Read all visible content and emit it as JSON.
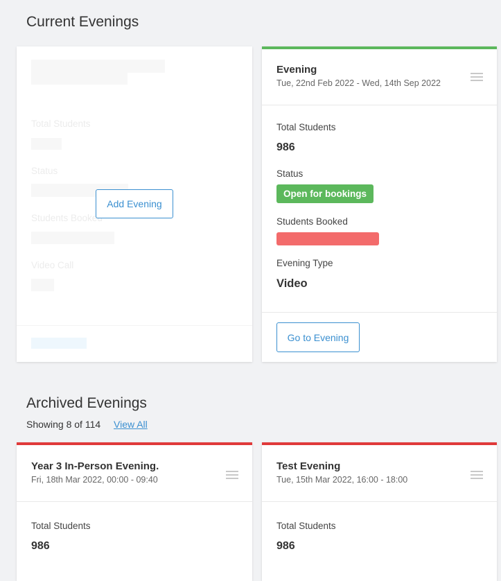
{
  "current": {
    "title": "Current Evenings",
    "placeholder_card": {
      "labels": [
        "Total Students",
        "Status",
        "Students Booked",
        "Video Call"
      ],
      "add_button": "Add Evening"
    },
    "evening_card": {
      "title": "Evening",
      "date_range": "Tue, 22nd Feb 2022 - Wed, 14th Sep 2022",
      "total_students_label": "Total Students",
      "total_students": "986",
      "status_label": "Status",
      "status": "Open for bookings",
      "students_booked_label": "Students Booked",
      "students_booked_fraction": 0.0,
      "evening_type_label": "Evening Type",
      "evening_type": "Video",
      "go_button": "Go to Evening"
    }
  },
  "archived": {
    "title": "Archived Evenings",
    "showing": "Showing 8 of 114",
    "view_all": "View All",
    "cards": [
      {
        "title": "Year 3 In-Person Evening.",
        "date": "Fri, 18th Mar 2022, 00:00 - 09:40",
        "total_students_label": "Total Students",
        "total_students": "986"
      },
      {
        "title": "Test Evening",
        "date": "Tue, 15th Mar 2022, 16:00 - 18:00",
        "total_students_label": "Total Students",
        "total_students": "986"
      }
    ]
  },
  "colors": {
    "accent": "#3a8fd0",
    "open_status": "#5cb85c",
    "archived_border": "#e03a3a",
    "booked_bar": "#f36b6b"
  }
}
